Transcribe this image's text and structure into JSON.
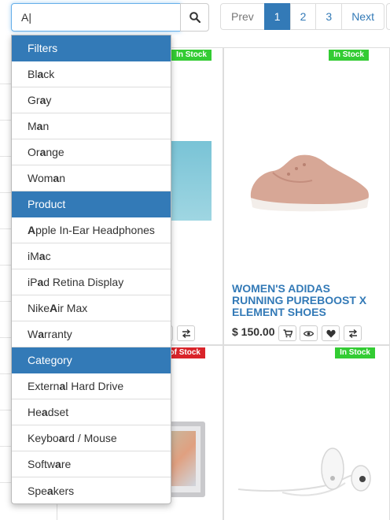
{
  "search": {
    "value": "A|"
  },
  "pagination": {
    "prev": "Prev",
    "pages": [
      "1",
      "2",
      "3"
    ],
    "active": "1",
    "next": "Next"
  },
  "products": [
    {
      "badge": "In Stock",
      "badge_color": "#33cc33"
    },
    {
      "badge": "In Stock",
      "badge_color": "#33cc33",
      "title": "WOMEN'S ADIDAS RUNNING PUREBOOST X ELEMENT SHOES",
      "price": "$ 150.00"
    },
    {
      "badge": "of Stock",
      "badge_color": "#d9242a"
    },
    {
      "badge": "In Stock",
      "badge_color": "#33cc33"
    }
  ],
  "dropdown": {
    "groups": [
      {
        "header": "Filters",
        "items": [
          {
            "pre": "Bl",
            "hl": "a",
            "post": "ck"
          },
          {
            "pre": "Gr",
            "hl": "a",
            "post": "y"
          },
          {
            "pre": "M",
            "hl": "a",
            "post": "n"
          },
          {
            "pre": "Or",
            "hl": "a",
            "post": "nge"
          },
          {
            "pre": "Wom",
            "hl": "a",
            "post": "n"
          }
        ]
      },
      {
        "header": "Product",
        "items": [
          {
            "pre": "",
            "hl": "A",
            "post": "pple In-Ear Headphones"
          },
          {
            "pre": "iM",
            "hl": "a",
            "post": "c"
          },
          {
            "pre": "iP",
            "hl": "a",
            "post": "d Retina Display"
          },
          {
            "pre": "Nike ",
            "hl": "A",
            "post": "ir Max"
          },
          {
            "pre": "W",
            "hl": "a",
            "post": "rranty"
          }
        ]
      },
      {
        "header": "Category",
        "items": [
          {
            "pre": "Extern",
            "hl": "a",
            "post": "l Hard Drive"
          },
          {
            "pre": "He",
            "hl": "a",
            "post": "dset"
          },
          {
            "pre": "Keybo",
            "hl": "a",
            "post": "rd / Mouse"
          },
          {
            "pre": "Softw",
            "hl": "a",
            "post": "re"
          },
          {
            "pre": "Spe",
            "hl": "a",
            "post": "kers"
          }
        ]
      }
    ]
  }
}
